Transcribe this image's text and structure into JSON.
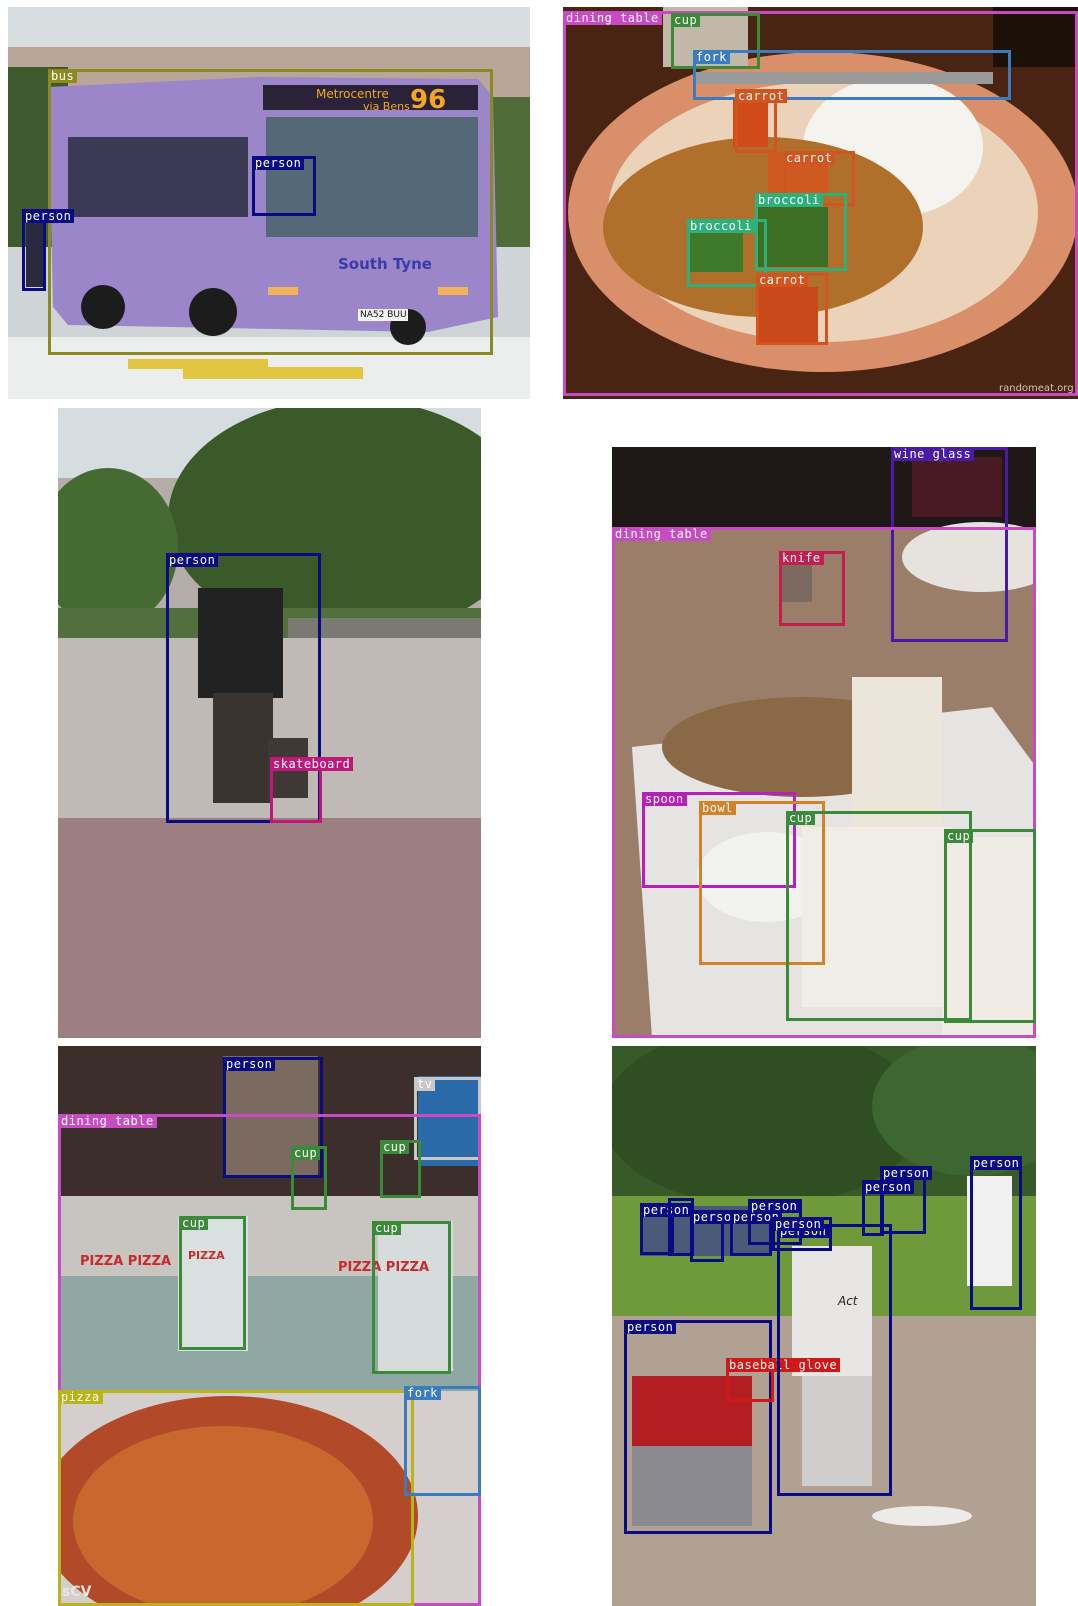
{
  "colors": {
    "bus": "#8a8a1e",
    "person": "#0a0a82",
    "dining_table": "#c84bc4",
    "cup": "#3a8a3a",
    "fork": "#3d7bbf",
    "carrot": "#d2541e",
    "broccoli": "#2eb07a",
    "skateboard": "#c0187a",
    "wine_glass": "#4a1aa6",
    "knife": "#c41e50",
    "spoon": "#b81eb8",
    "bowl": "#d4822a",
    "tv": "#c8c8c8",
    "pizza": "#b8b41a",
    "baseball_glove": "#d01818"
  },
  "panels": {
    "bus": {
      "photo_text": {
        "sign_route": "Metrocentre",
        "sign_via": "via Bens",
        "sign_number": "96",
        "livery": "South Tyne",
        "plate": "NA52 BUU"
      },
      "labels": {
        "bus": "bus",
        "person_driver": "person",
        "person_walker": "person"
      }
    },
    "meal": {
      "photo_text": {
        "watermark": "randomeat.org"
      },
      "labels": {
        "dining_table": "dining table",
        "cup": "cup",
        "fork": "fork",
        "carrot_1": "carrot",
        "carrot_2": "carrot",
        "broccoli_1": "broccoli",
        "broccoli_2": "broccoli",
        "carrot_3": "carrot"
      }
    },
    "skate": {
      "labels": {
        "person": "person",
        "skateboard": "skateboard"
      }
    },
    "bread": {
      "labels": {
        "wine_glass": "wine glass",
        "dining_table": "dining table",
        "knife": "knife",
        "spoon": "spoon",
        "bowl": "bowl",
        "cup_1": "cup",
        "cup_2": "cup"
      }
    },
    "pizza": {
      "photo_text": {
        "box_1": "PIZZA PIZZA",
        "box_2": "PIZZA",
        "box_3": "PIZZA PIZZA",
        "corner": "sCV"
      },
      "labels": {
        "person": "person",
        "tv": "tv",
        "dining_table": "dining table",
        "cup_1": "cup",
        "cup_2": "cup",
        "cup_3": "cup",
        "cup_4": "cup",
        "pizza": "pizza",
        "fork": "fork"
      }
    },
    "baseball": {
      "photo_text": {
        "shirt": "Act"
      },
      "labels": {
        "person_catcher": "person",
        "baseball_glove": "baseball glove",
        "person_batter": "person",
        "person_right": "person",
        "person_bg1": "person",
        "person_bg2": "person",
        "person_bg3": "person",
        "person_bg4": "person",
        "person_bg5": "person",
        "person_bg6": "person",
        "person_bg7": "person",
        "person_bg8": "person"
      }
    }
  }
}
